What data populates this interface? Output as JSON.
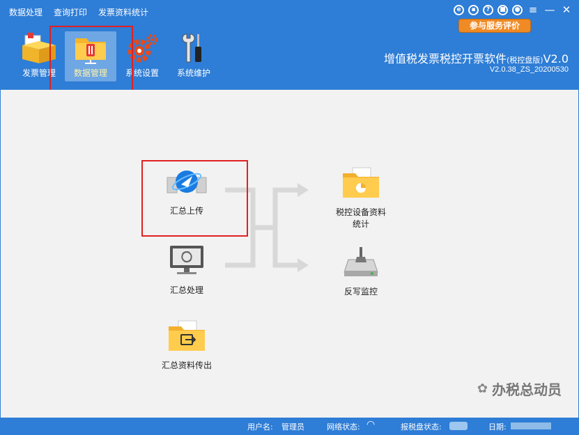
{
  "menu": [
    "数据处理",
    "查询打印",
    "发票资料统计"
  ],
  "window_controls": [
    "gift-icon",
    "feedback-icon",
    "help-icon",
    "lock-icon",
    "user-icon",
    "menu-icon",
    "minimize-icon",
    "close-icon"
  ],
  "eval_button": "参与服务评价",
  "toolbar": [
    {
      "label": "发票管理",
      "icon": "invoice-box-icon"
    },
    {
      "label": "数据管理",
      "icon": "data-folder-icon",
      "active": true
    },
    {
      "label": "系统设置",
      "icon": "gear-icon"
    },
    {
      "label": "系统维护",
      "icon": "tools-icon"
    }
  ],
  "brand": {
    "title": "增值税发票税控开票软件",
    "edition": "(税控盘版)",
    "ver_suffix": "V2.0",
    "version": "V2.0.38_ZS_20200530"
  },
  "items": {
    "upload": "汇总上传",
    "process": "汇总处理",
    "export": "汇总资料传出",
    "stats_line1": "税控设备资料",
    "stats_line2": "统计",
    "monitor": "反写监控"
  },
  "status": {
    "user_label": "用户名:",
    "user_value": "管理员",
    "network_label": "网络状态:",
    "disk_label": "报税盘状态:",
    "date_label": "日期:"
  },
  "watermark": "办税总动员",
  "colors": {
    "header": "#2e7dd6",
    "accent": "#f08a24",
    "annotation": "#e02020"
  }
}
